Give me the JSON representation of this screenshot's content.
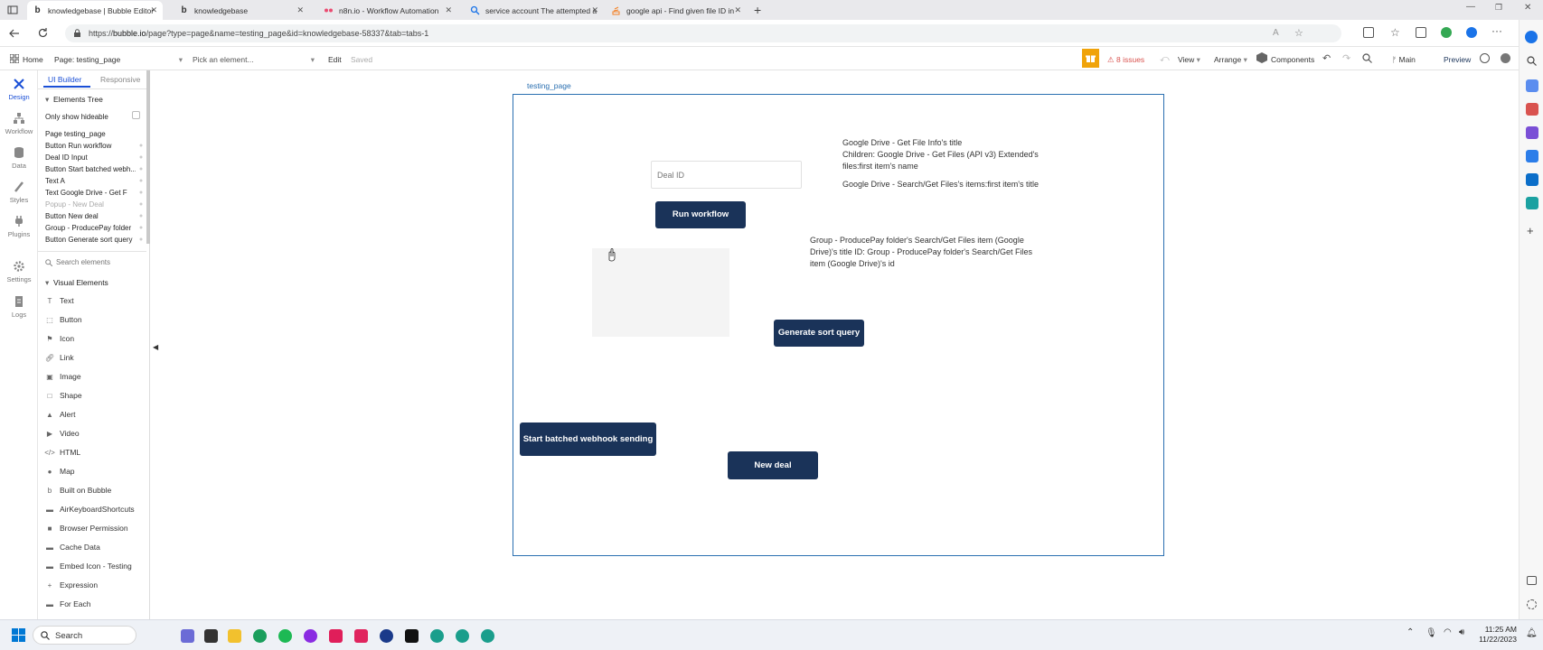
{
  "browser": {
    "tabs": [
      {
        "title": "knowledgebase | Bubble Editor",
        "favicon": "b"
      },
      {
        "title": "knowledgebase",
        "favicon": "b"
      },
      {
        "title": "n8n.io - Workflow Automation",
        "favicon": "n8n-icon"
      },
      {
        "title": "service account The attempted a",
        "favicon": "search-icon"
      },
      {
        "title": "google api - Find given file ID in",
        "favicon": "stackoverflow-icon"
      }
    ],
    "url_prefix": "https://",
    "url_host": "bubble.io",
    "url_path": "/page?type=page&name=testing_page&id=knowledgebase-58337&tab=tabs-1"
  },
  "editor": {
    "home": "Home",
    "page_selector": "Page: testing_page",
    "pick_element": "Pick an element...",
    "edit": "Edit",
    "saved": "Saved",
    "issues": "8 issues",
    "view": "View",
    "arrange": "Arrange",
    "components": "Components",
    "branch": "Main",
    "preview": "Preview",
    "colors": {
      "accent": "#1a3359",
      "issues": "#d9534f",
      "warning": "#f0a30a"
    }
  },
  "nav": [
    {
      "label": "Design",
      "icon": "design-icon"
    },
    {
      "label": "Workflow",
      "icon": "workflow-icon"
    },
    {
      "label": "Data",
      "icon": "data-icon"
    },
    {
      "label": "Styles",
      "icon": "styles-icon"
    },
    {
      "label": "Plugins",
      "icon": "plugins-icon"
    },
    {
      "label": "Settings",
      "icon": "settings-icon"
    },
    {
      "label": "Logs",
      "icon": "logs-icon"
    }
  ],
  "panel": {
    "tab_ui": "UI Builder",
    "tab_responsive": "Responsive",
    "tree_title": "Elements Tree",
    "only_hideable": "Only show hideable",
    "tree_items": [
      "Page testing_page",
      "Button Run workflow",
      "Deal ID Input",
      "Button Start batched webh...",
      "Text A",
      "Text Google Drive - Get F",
      "Popup - New Deal",
      "Button New deal",
      "Group - ProducePay folder",
      "Button Generate sort query"
    ],
    "search_placeholder": "Search elements",
    "visual_title": "Visual Elements",
    "visual_items": [
      "Text",
      "Button",
      "Icon",
      "Link",
      "Image",
      "Shape",
      "Alert",
      "Video",
      "HTML",
      "Map",
      "Built on Bubble",
      "AirKeyboardShortcuts",
      "Browser Permission",
      "Cache Data",
      "Embed Icon - Testing",
      "Expression",
      "For Each"
    ]
  },
  "canvas": {
    "page_label": "testing_page",
    "deal_id_placeholder": "Deal ID",
    "run_workflow": "Run workflow",
    "generate_sort": "Generate sort query",
    "start_batched": "Start batched webhook sending",
    "new_deal": "New deal",
    "text_drive_1": "Google Drive - Get File Info's title",
    "text_drive_2": "Children: Google Drive - Get Files (API v3) Extended's files:first item's name",
    "text_drive_3": "Google Drive - Search/Get Files's items:first item's title",
    "text_group": "Group - ProducePay folder's Search/Get Files item (Google Drive)'s title ID: Group - ProducePay folder's Search/Get Files item (Google Drive)'s id"
  },
  "taskbar": {
    "search": "Search",
    "time": "11:25 AM",
    "date": "11/22/2023"
  }
}
